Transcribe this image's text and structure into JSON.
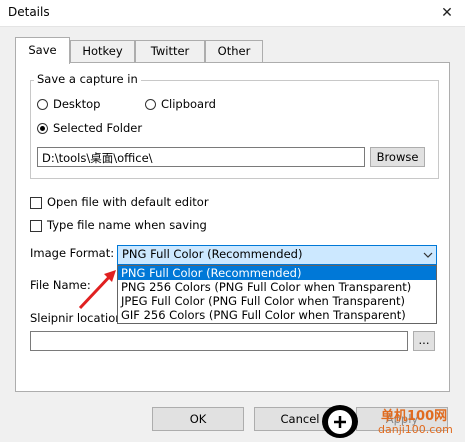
{
  "window": {
    "title": "Details",
    "close_glyph": "✕"
  },
  "tabs": [
    {
      "label": "Save",
      "active": true
    },
    {
      "label": "Hotkey",
      "active": false
    },
    {
      "label": "Twitter",
      "active": false
    },
    {
      "label": "Other",
      "active": false
    }
  ],
  "save_group": {
    "legend": "Save a capture in",
    "radio_desktop": "Desktop",
    "radio_clipboard": "Clipboard",
    "radio_selected_folder": "Selected Folder",
    "selected": "Selected Folder",
    "folder_path": "D:\\tools\\桌面\\office\\",
    "browse_label": "Browse"
  },
  "options": {
    "open_default_editor": {
      "label": "Open file with default editor",
      "checked": false
    },
    "type_file_name": {
      "label": "Type file name when saving",
      "checked": false
    }
  },
  "image_format": {
    "label": "Image Format:",
    "selected": "PNG Full Color (Recommended)",
    "options": [
      "PNG Full Color (Recommended)",
      "PNG 256 Colors (PNG Full Color when Transparent)",
      "JPEG Full Color (PNG Full Color when Transparent)",
      "GIF 256 Colors (PNG Full Color when Transparent)"
    ]
  },
  "file_name": {
    "label": "File Name:"
  },
  "sleipnir": {
    "label": "Sleipnir location:",
    "value": "",
    "browse_label": "..."
  },
  "footer": {
    "ok_label": "OK",
    "cancel_label": "Cancel",
    "apply_label": "Apply"
  },
  "watermark": {
    "site": "单机100网",
    "url": "danji100.com"
  },
  "colors": {
    "accent": "#0078d7",
    "select_bg": "#cce8ff",
    "arrow": "#e02020"
  }
}
